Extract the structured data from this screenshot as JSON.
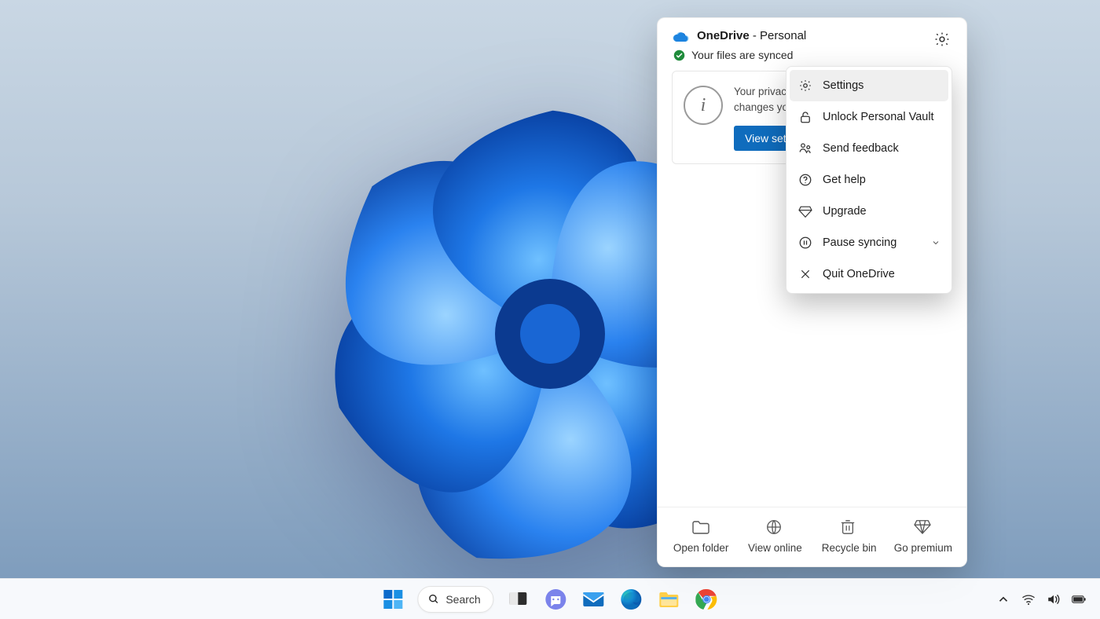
{
  "onedrive": {
    "title_prefix": "OneDrive",
    "title_separator": " - ",
    "title_suffix": "Personal",
    "status_text": "Your files are synced",
    "card": {
      "line1": "Your privacy",
      "line2": "changes you",
      "button_label": "View setti"
    },
    "settings_menu": {
      "items": [
        {
          "label": "Settings",
          "icon": "gear-icon",
          "selected": true
        },
        {
          "label": "Unlock Personal Vault",
          "icon": "unlock-icon",
          "selected": false
        },
        {
          "label": "Send feedback",
          "icon": "feedback-icon",
          "selected": false
        },
        {
          "label": "Get help",
          "icon": "help-icon",
          "selected": false
        },
        {
          "label": "Upgrade",
          "icon": "diamond-icon",
          "selected": false
        },
        {
          "label": "Pause syncing",
          "icon": "pause-icon",
          "selected": false,
          "has_submenu": true
        },
        {
          "label": "Quit OneDrive",
          "icon": "close-icon",
          "selected": false
        }
      ]
    },
    "footer": [
      {
        "label": "Open folder",
        "icon": "folder-icon"
      },
      {
        "label": "View online",
        "icon": "globe-icon"
      },
      {
        "label": "Recycle bin",
        "icon": "trash-icon"
      },
      {
        "label": "Go premium",
        "icon": "diamond-icon"
      }
    ]
  },
  "taskbar": {
    "search_label": "Search",
    "pinned": [
      "start-icon",
      "search-pill",
      "taskview-icon",
      "chat-icon",
      "mail-icon",
      "edge-icon",
      "explorer-icon",
      "chrome-icon"
    ],
    "tray": [
      "chevron-up-icon",
      "wifi-icon",
      "volume-icon",
      "battery-icon"
    ]
  }
}
